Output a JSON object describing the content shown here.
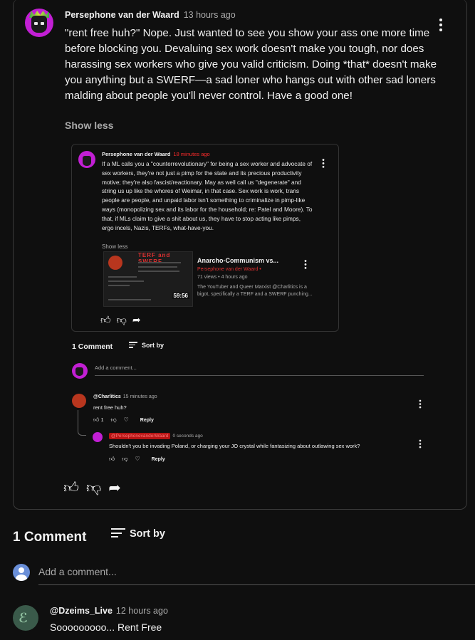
{
  "top_comment": {
    "author": "Persephone van der Waard",
    "time": "13 hours ago",
    "text": "\"rent free huh?\" Nope. Just wanted to see you show your ass one more time before blocking you. Devaluing sex work doesn't make you tough, nor does harassing sex workers who give you valid criticism. Doing *that* doesn't make you anything but a SWERF—a sad loner who hangs out with other sad loners malding about people you'll never control. Have a good one!",
    "show_less": "Show less"
  },
  "embed": {
    "author": "Persephone van der Waard",
    "time": "18 minutes ago",
    "text": "If a ML calls you a \"counterrevolutionary\" for being a sex worker and advocate of sex workers, they're not just a pimp for the state and its precious productivity motive; they're also fascist/reactionary. May as well call us \"degenerate\" and string us up like the whores of Weimar, in that case. Sex work is work, trans people are people, and unpaid labor isn't something to criminalize in pimp-like ways (monopolizing sex and its labor for the household; re: Patel and Moore). To that, if MLs claim to give a shit about us, they have to stop acting like pimps, ergo incels, Nazis, TERFs, what-have-you.",
    "show_less": "Show less",
    "video": {
      "thumb_title": "TERF and SWERF",
      "duration": "59:56",
      "title": "Anarcho-Communism vs...",
      "channel": "Persephone van der Waard •",
      "meta": "71 views • 4 hours ago",
      "desc": "The YouTuber and Queer Marxist @Charlitics is a bigot, specifically a TERF and a SWERF punching..."
    },
    "comment_count": "1 Comment",
    "sort_label": "Sort by",
    "add_placeholder": "Add a comment...",
    "reply1": {
      "author": "@Charlitics",
      "time": "15 minutes ago",
      "text": "rent free huh?",
      "likes": "1",
      "reply_label": "Reply"
    },
    "reply2": {
      "author": "@PersephonevanderWaard",
      "time": "0 seconds ago",
      "text": "Shouldn't you be invading Poland, or charging your JO crystal while fantasizing about outlawing sex work?",
      "reply_label": "Reply"
    }
  },
  "comments_section": {
    "count": "1 Comment",
    "sort_label": "Sort by",
    "add_placeholder": "Add a comment..."
  },
  "comment": {
    "author": "@Dzeims_Live",
    "time": "12 hours ago",
    "text": "Sooooooooo... Rent Free"
  },
  "icons": {
    "like": "thumbs-up-icon",
    "dislike": "thumbs-down-icon",
    "share": "share-icon",
    "menu": "more-vert-icon",
    "sort": "sort-icon"
  }
}
